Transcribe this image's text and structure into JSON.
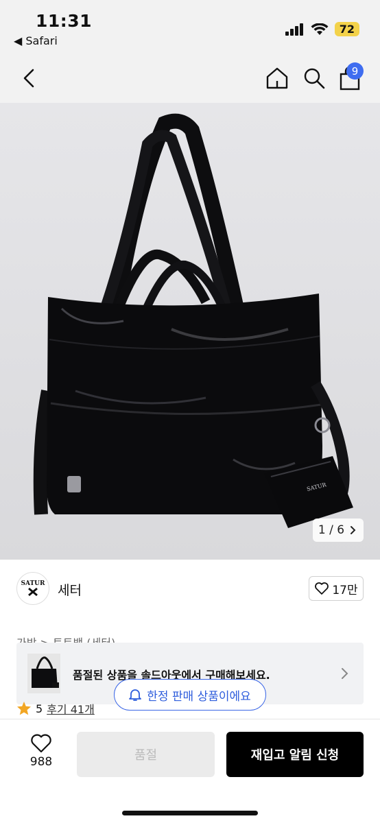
{
  "status_bar": {
    "time": "11:31",
    "back_app": "◀ Safari",
    "battery": "72"
  },
  "nav": {
    "cart_count": "9"
  },
  "gallery": {
    "counter": "1 / 6",
    "logo_text": "SATUR"
  },
  "brand": {
    "logo_text_top": "SATUR",
    "name": "세터",
    "like_count": "17만"
  },
  "breadcrumb": "가방 > 토트백 (세터)",
  "banner": {
    "text": "품절된 상품을 솔드아웃에서 구매해보세요."
  },
  "limited": {
    "label": "한정 판매 상품이에요"
  },
  "rating": {
    "score": "5",
    "reviews": "후기 41개"
  },
  "bottom": {
    "wish_count": "988",
    "soldout_label": "품절",
    "restock_label": "재입고 알림 신청"
  },
  "colors": {
    "accent": "#3a66e6",
    "badge": "#3f6df0",
    "cta": "#000000"
  }
}
